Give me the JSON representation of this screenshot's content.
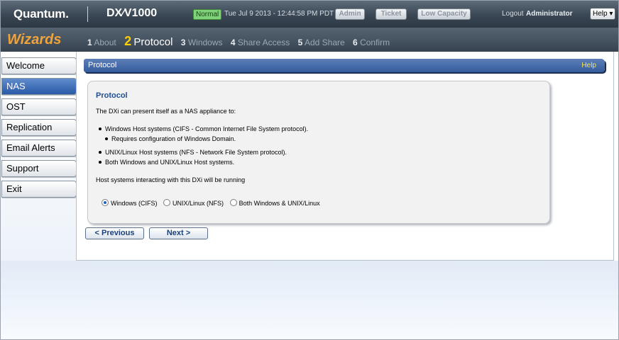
{
  "header": {
    "logo": "Quantum.",
    "product": "DX⁄V1000",
    "status": "Normal",
    "datetime": "Tue Jul 9 2013 - 12:44:58 PM PDT",
    "buttons": [
      "Admin",
      "Ticket",
      "Low Capacity"
    ],
    "logout": "Logout",
    "user": "Administrator",
    "help": "Help ▾"
  },
  "wizard": {
    "title": "Wizards",
    "steps": [
      {
        "num": "1",
        "label": "About"
      },
      {
        "num": "2",
        "label": "Protocol"
      },
      {
        "num": "3",
        "label": "Windows"
      },
      {
        "num": "4",
        "label": "Share Access"
      },
      {
        "num": "5",
        "label": "Add Share"
      },
      {
        "num": "6",
        "label": "Confirm"
      }
    ]
  },
  "sidebar": {
    "items": [
      {
        "label": "Welcome"
      },
      {
        "label": "NAS"
      },
      {
        "label": "OST"
      },
      {
        "label": "Replication"
      },
      {
        "label": "Email Alerts"
      },
      {
        "label": "Support"
      },
      {
        "label": "Exit"
      }
    ]
  },
  "section": {
    "title": "Protocol",
    "help": "Help"
  },
  "panel": {
    "title": "Protocol",
    "intro": "The DXi can present itself as a NAS appliance to:",
    "bullets": [
      "Windows Host systems (CIFS - Common Internet File System protocol).",
      "Requires configuration of Windows Domain.",
      "UNIX/Linux Host systems (NFS - Network File System protocol).",
      "Both Windows and UNIX/Linux Host systems."
    ],
    "question": "Host systems interacting with this DXi will be running",
    "options": [
      "Windows (CIFS)",
      "UNIX/Linux (NFS)",
      "Both Windows & UNIX/Linux"
    ]
  },
  "buttons": {
    "previous": "< Previous",
    "next": "Next >"
  }
}
